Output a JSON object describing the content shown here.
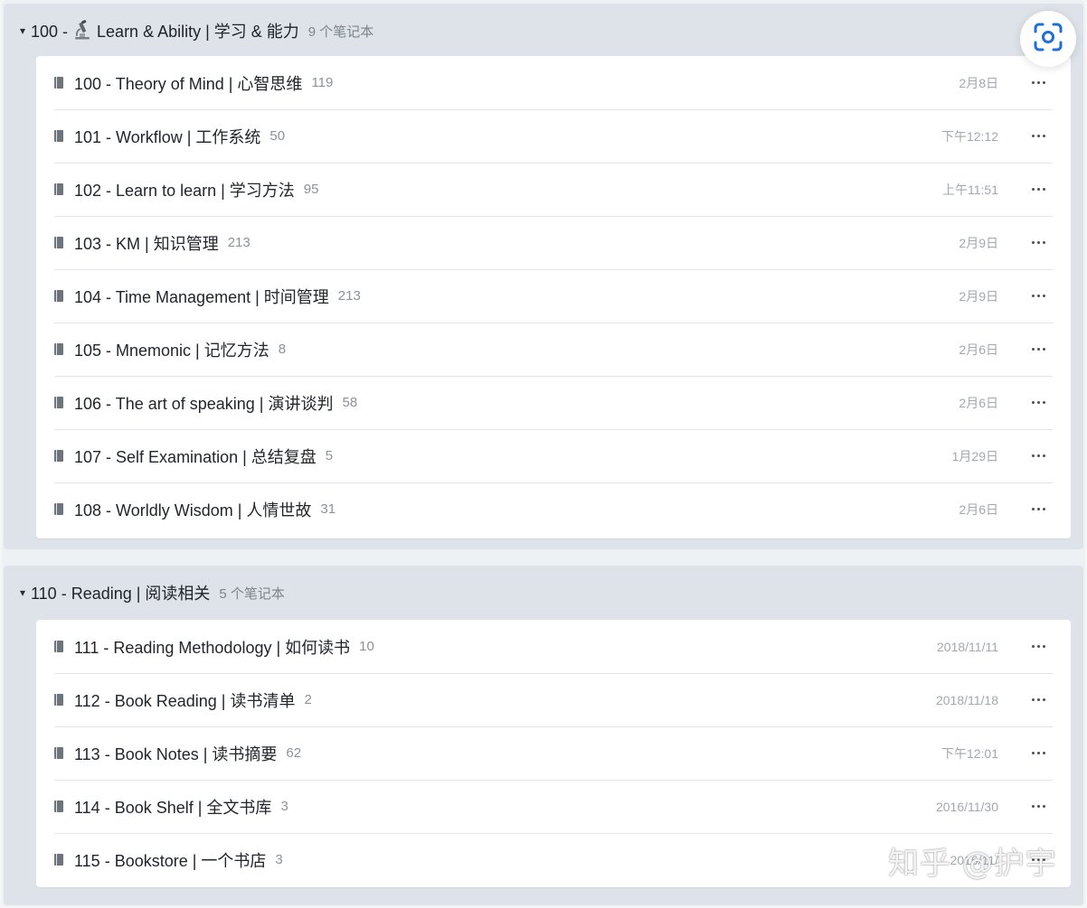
{
  "colors": {
    "group_header_bg": "#dde3e9",
    "card_bg": "#ffffff",
    "date_text": "#a1a8af",
    "accent_scan": "#1f6fd6"
  },
  "groups": [
    {
      "title_prefix": "100 -",
      "icon": "microscope-icon",
      "title": "Learn & Ability | 学习 & 能力",
      "count": "9 个笔记本",
      "notebooks": [
        {
          "title": "100 - Theory of Mind | 心智思维",
          "count": "119",
          "date": "2月8日"
        },
        {
          "title": "101 - Workflow | 工作系统",
          "count": "50",
          "date": "下午12:12"
        },
        {
          "title": "102 - Learn to learn | 学习方法",
          "count": "95",
          "date": "上午11:51"
        },
        {
          "title": "103 - KM | 知识管理",
          "count": "213",
          "date": "2月9日"
        },
        {
          "title": "104 - Time Management | 时间管理",
          "count": "213",
          "date": "2月9日"
        },
        {
          "title": "105 - Mnemonic | 记忆方法",
          "count": "8",
          "date": "2月6日"
        },
        {
          "title": "106 - The art of speaking | 演讲谈判",
          "count": "58",
          "date": "2月6日"
        },
        {
          "title": "107 - Self Examination | 总结复盘",
          "count": "5",
          "date": "1月29日"
        },
        {
          "title": "108 - Worldly Wisdom | 人情世故",
          "count": "31",
          "date": "2月6日"
        }
      ]
    },
    {
      "title": "110 - Reading | 阅读相关",
      "count": "5 个笔记本",
      "notebooks": [
        {
          "title": "111 - Reading Methodology | 如何读书",
          "count": "10",
          "date": "2018/11/11"
        },
        {
          "title": "112 - Book Reading | 读书清单",
          "count": "2",
          "date": "2018/11/18"
        },
        {
          "title": "113 - Book Notes | 读书摘要",
          "count": "62",
          "date": "下午12:01"
        },
        {
          "title": "114 - Book Shelf | 全文书库",
          "count": "3",
          "date": "2016/11/30"
        },
        {
          "title": "115 - Bookstore | 一个书店",
          "count": "3",
          "date": "2016/11/"
        }
      ]
    }
  ],
  "watermark": "知乎 @护宇",
  "scan_button_icon": "scan-lens-icon"
}
